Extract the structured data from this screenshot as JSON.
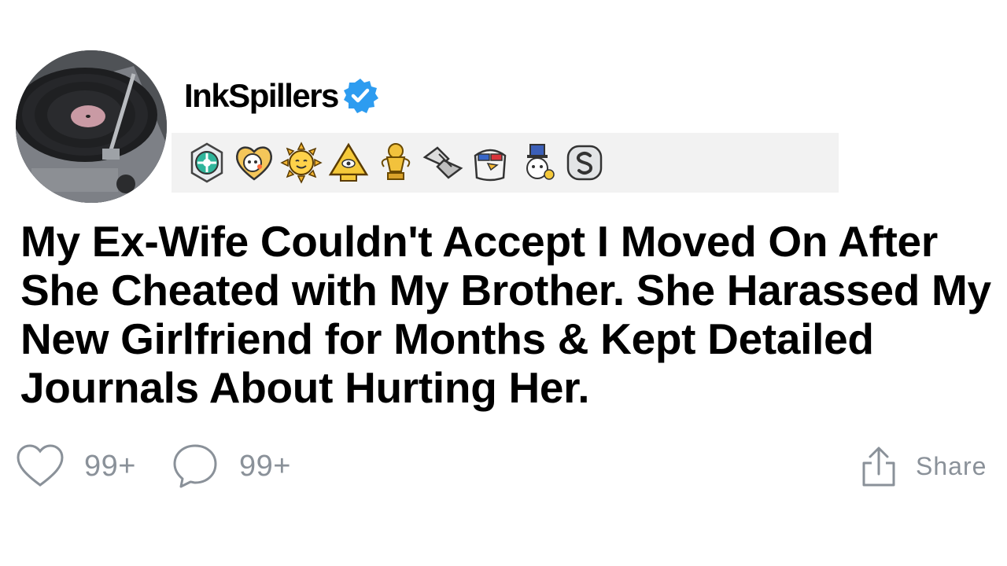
{
  "post": {
    "username": "InkSpillers",
    "title": "My Ex-Wife Couldn't Accept I Moved On After She Cheated with My Brother. She Harassed My New Girlfriend for Months & Kept Detailed Journals About Hurting Her.",
    "likes_count": "99+",
    "comments_count": "99+",
    "share_label": "Share"
  },
  "awards": [
    {
      "name": "helpful-award-icon"
    },
    {
      "name": "wholesome-award-icon"
    },
    {
      "name": "sun-award-icon"
    },
    {
      "name": "pyramid-award-icon"
    },
    {
      "name": "gold-trophy-award-icon"
    },
    {
      "name": "handshake-award-icon"
    },
    {
      "name": "eagle-award-icon"
    },
    {
      "name": "uncle-sam-award-icon"
    },
    {
      "name": "silver-award-icon"
    }
  ],
  "colors": {
    "verified_badge": "#2d9cf0",
    "action_gray": "#8a9199",
    "awards_bg": "#f2f2f2"
  }
}
